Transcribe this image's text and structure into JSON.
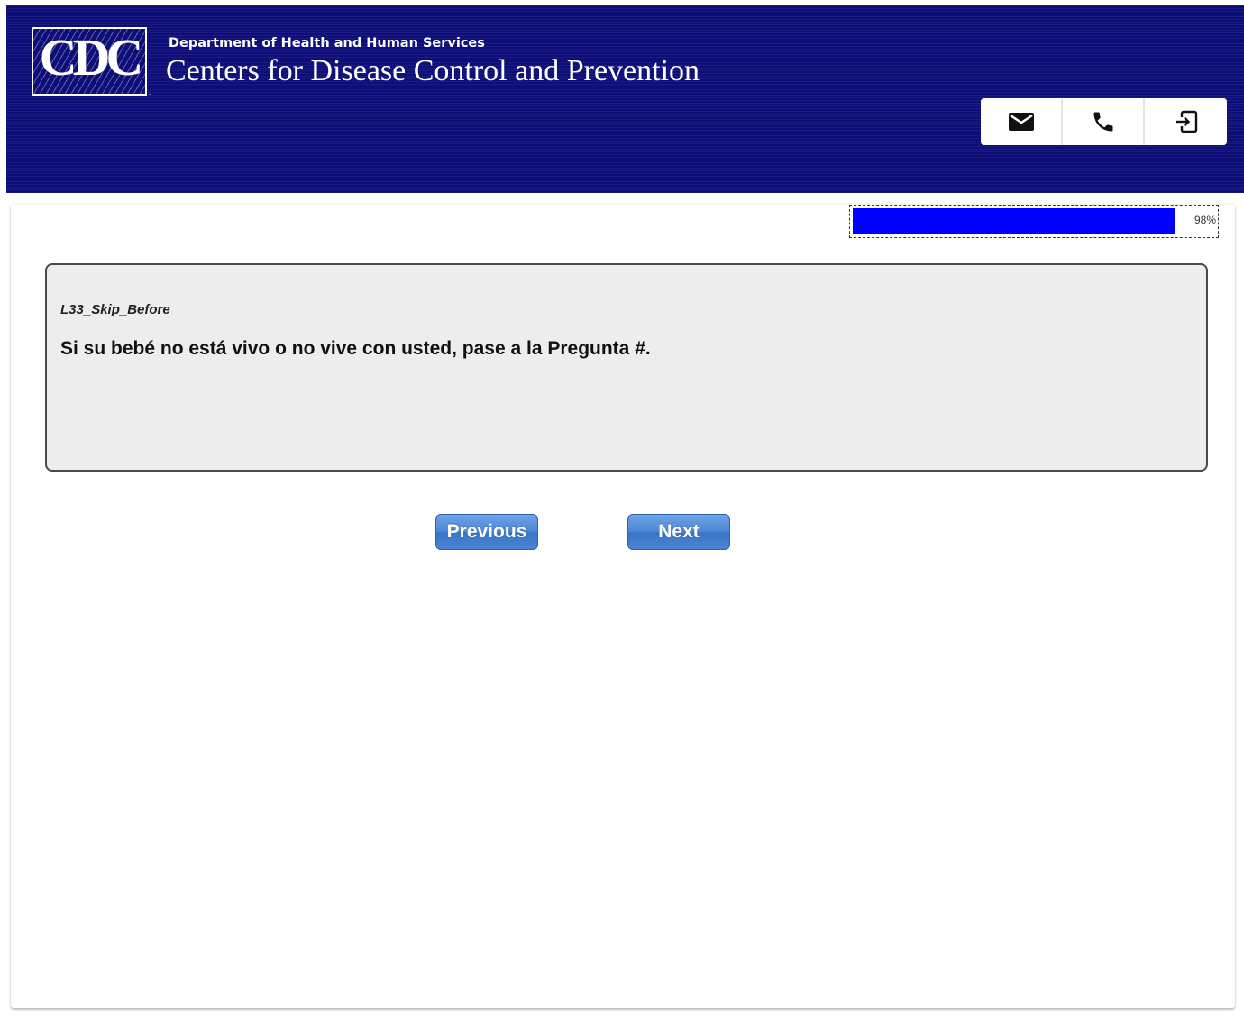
{
  "header": {
    "logo_text": "CDC",
    "logo_tm": ".",
    "department": "Department of Health and Human Services",
    "agency": "Centers for Disease Control and Prevention",
    "background_color": "#0e0e78",
    "icons": [
      "mail-icon",
      "phone-icon",
      "sign-out-icon"
    ]
  },
  "progress": {
    "percent": 98,
    "label": "98%",
    "fill_color": "#0000ff"
  },
  "question": {
    "id_label": "L33_Skip_Before",
    "text": "Si su bebé no está vivo o no vive con usted, pase a la Pregunta #."
  },
  "navigation": {
    "previous_label": "Previous",
    "next_label": "Next"
  }
}
